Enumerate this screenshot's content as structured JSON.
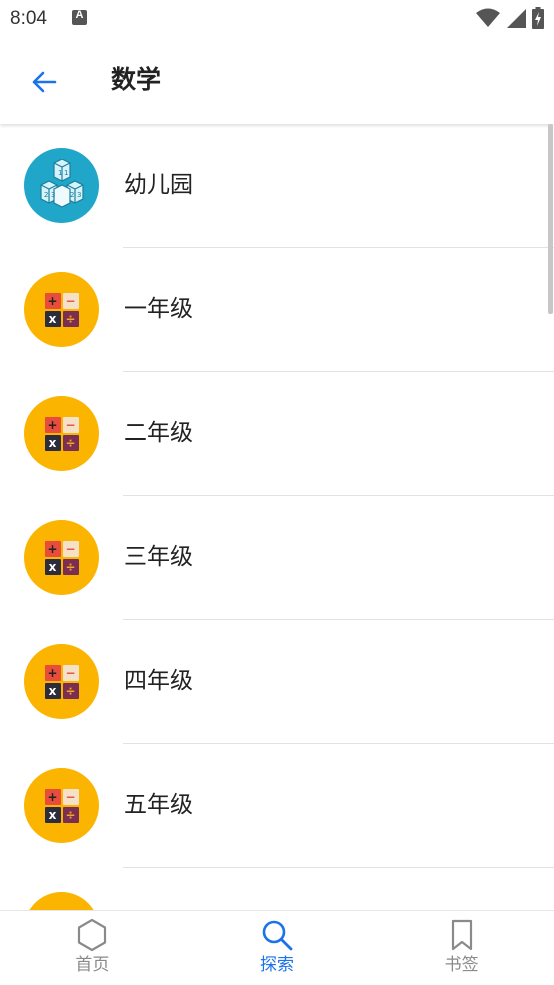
{
  "status_bar": {
    "time": "8:04",
    "notification_icon_letter": "A",
    "icons": [
      "wifi-icon",
      "signal-icon",
      "battery-charging-icon"
    ]
  },
  "app_bar": {
    "back_icon": "arrow-back-icon",
    "title": "数学"
  },
  "list": {
    "items": [
      {
        "label": "幼儿园",
        "icon": "blocks-icon",
        "color": "#1fa6c9"
      },
      {
        "label": "一年级",
        "icon": "calculator-icon",
        "color": "#fbb400"
      },
      {
        "label": "二年级",
        "icon": "calculator-icon",
        "color": "#fbb400"
      },
      {
        "label": "三年级",
        "icon": "calculator-icon",
        "color": "#fbb400"
      },
      {
        "label": "四年级",
        "icon": "calculator-icon",
        "color": "#fbb400"
      },
      {
        "label": "五年级",
        "icon": "calculator-icon",
        "color": "#fbb400"
      },
      {
        "label": "",
        "icon": "calculator-icon",
        "color": "#fbb400"
      }
    ],
    "calc_symbols": {
      "plus": "+",
      "minus": "−",
      "times": "x",
      "divide": "÷"
    }
  },
  "bottom_nav": {
    "items": [
      {
        "label": "首页",
        "icon": "hexagon-home-icon",
        "active": false
      },
      {
        "label": "探索",
        "icon": "search-icon",
        "active": true
      },
      {
        "label": "书签",
        "icon": "bookmark-icon",
        "active": false
      }
    ]
  },
  "colors": {
    "accent": "#1a73e8",
    "inactive": "#8a8a8a",
    "kindergarten_avatar": "#1fa6c9",
    "grade_avatar": "#fbb400"
  }
}
